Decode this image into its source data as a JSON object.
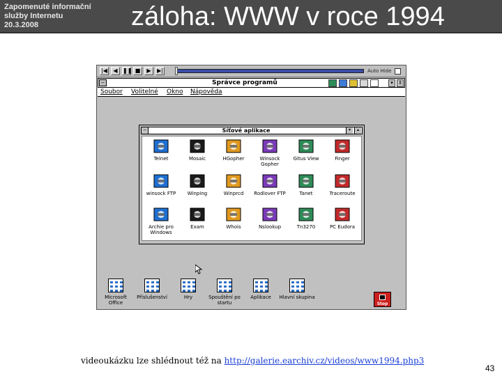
{
  "header": {
    "subtitle_lines": [
      "Zapomenuté informační",
      "služby Internetu",
      "20.3.2008"
    ],
    "title": "záloha: WWW v roce 1994",
    "background": "#4a4a4a"
  },
  "media_player": {
    "buttons": [
      "|◀",
      "◀",
      "❚❚",
      "■",
      "▶",
      "▶|"
    ],
    "auto_hide_label": "Auto Hide",
    "track_color": "#3a4ea8"
  },
  "program_manager": {
    "title": "Správce programů",
    "menu": [
      "Soubor",
      "Volitelné",
      "Okno",
      "Nápověda"
    ]
  },
  "network_apps_window": {
    "title": "Síťové aplikace",
    "apps": [
      {
        "label": "Telnet",
        "icon": "telnet-icon"
      },
      {
        "label": "Mosaic",
        "icon": "mosaic-icon"
      },
      {
        "label": "HGopher",
        "icon": "hgopher-icon"
      },
      {
        "label": "Winsock Gopher",
        "icon": "winsock-gopher-icon"
      },
      {
        "label": "Gitus View",
        "icon": "gitus-view-icon"
      },
      {
        "label": "Finger",
        "icon": "finger-icon"
      },
      {
        "label": "winsock FTP",
        "icon": "ftp-icon"
      },
      {
        "label": "Winping",
        "icon": "ping-icon"
      },
      {
        "label": "Winprcd",
        "icon": "winprcd-icon"
      },
      {
        "label": "Rodlover FTP",
        "icon": "rodlover-ftp-icon"
      },
      {
        "label": "Tanet",
        "icon": "tanet-icon"
      },
      {
        "label": "Traceroute",
        "icon": "traceroute-icon"
      },
      {
        "label": "Archie pro Windows",
        "icon": "archie-icon"
      },
      {
        "label": "Exam",
        "icon": "exam-icon"
      },
      {
        "label": "Whois",
        "icon": "whois-icon"
      },
      {
        "label": "Nslookup",
        "icon": "nslookup-icon"
      },
      {
        "label": "Tn3270",
        "icon": "tn3270-icon"
      },
      {
        "label": "PC Eudora",
        "icon": "eudora-icon"
      }
    ]
  },
  "program_groups": [
    {
      "label": "Microsoft Office"
    },
    {
      "label": "Příslušenství"
    },
    {
      "label": "Hry"
    },
    {
      "label": "Spouštění po startu"
    },
    {
      "label": "Aplikace"
    },
    {
      "label": "Hlavní skupina"
    }
  ],
  "stop_button": {
    "label": "Stop",
    "color": "#cc1f1f"
  },
  "footer": {
    "text": "videoukázku lze shlédnout též na ",
    "link": "http://galerie.earchiv.cz/videos/www1994.php3",
    "link_color": "#1a3fd6"
  },
  "slide_number": "43"
}
